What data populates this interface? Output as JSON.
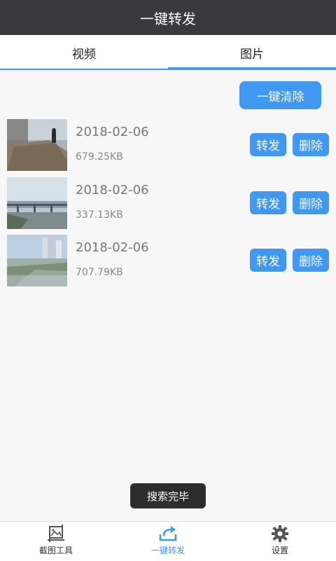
{
  "header": {
    "title": "一键转发"
  },
  "tabs": [
    {
      "label": "视频"
    },
    {
      "label": "图片"
    }
  ],
  "actions": {
    "clear_all": "一键清除"
  },
  "items": [
    {
      "date": "2018-02-06",
      "size": "679.25KB",
      "forward": "转发",
      "delete": "删除"
    },
    {
      "date": "2018-02-06",
      "size": "337.13KB",
      "forward": "转发",
      "delete": "删除"
    },
    {
      "date": "2018-02-06",
      "size": "707.79KB",
      "forward": "转发",
      "delete": "删除"
    }
  ],
  "toast": {
    "text": "搜索完毕"
  },
  "bottom_nav": [
    {
      "label": "截图工具",
      "icon": "image-crop-icon"
    },
    {
      "label": "一键转发",
      "icon": "share-forward-icon"
    },
    {
      "label": "设置",
      "icon": "gear-icon"
    }
  ],
  "colors": {
    "accent": "#3f98f2",
    "header_bg": "#3a3a3c"
  }
}
